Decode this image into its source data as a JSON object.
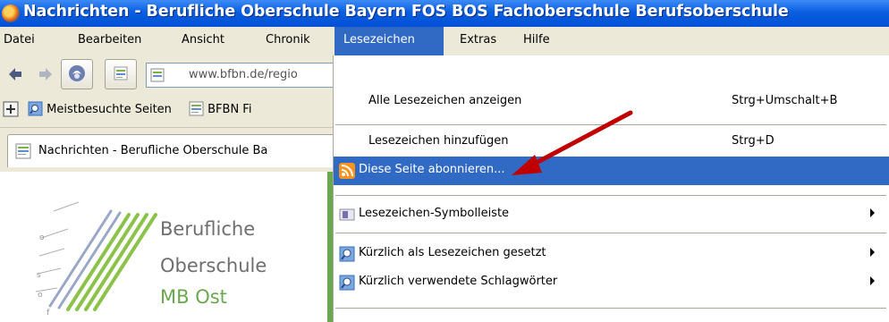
{
  "window": {
    "title": "Nachrichten - Berufliche Oberschule Bayern FOS BOS Fachoberschule Berufsoberschule"
  },
  "menubar": {
    "items": [
      "Datei",
      "Bearbeiten",
      "Ansicht",
      "Chronik",
      "Lesezeichen",
      "Extras",
      "Hilfe"
    ]
  },
  "navbar": {
    "url_host": "www.bfbn.de",
    "url_path": "/regio"
  },
  "bookmarks": {
    "items": [
      "Meistbesuchte Seiten",
      "BFBN Fi"
    ]
  },
  "tab": {
    "title": "Nachrichten - Berufliche Oberschule Ba"
  },
  "logo": {
    "line1": "Berufliche",
    "line2": "Oberschule",
    "line3": "MB Ost",
    "ruler_letters": [
      "o",
      "s",
      "o",
      "f"
    ]
  },
  "menu": {
    "items": [
      {
        "label": "Alle Lesezeichen anzeigen",
        "shortcut": "Strg+Umschalt+B"
      },
      {
        "label": "Lesezeichen hinzufügen",
        "shortcut": "Strg+D"
      },
      {
        "label": "Diese Seite abonnieren...",
        "shortcut": ""
      },
      {
        "label": "Lesezeichen-Symbolleiste",
        "shortcut": ""
      },
      {
        "label": "Kürzlich als Lesezeichen gesetzt",
        "shortcut": ""
      },
      {
        "label": "Kürzlich verwendete Schlagwörter",
        "shortcut": ""
      }
    ]
  },
  "colors": {
    "highlight": "#316ac5",
    "titlebar": "#0a5fe0",
    "arrow": "#c00000",
    "logo_green": "#6aa84f"
  },
  "icons": [
    "firefox-icon",
    "back-arrow-icon",
    "forward-arrow-icon",
    "home-icon",
    "page-icon",
    "rss-feed-icon",
    "toolbar-folder-icon",
    "search-folder-icon",
    "submenu-arrow-icon"
  ]
}
